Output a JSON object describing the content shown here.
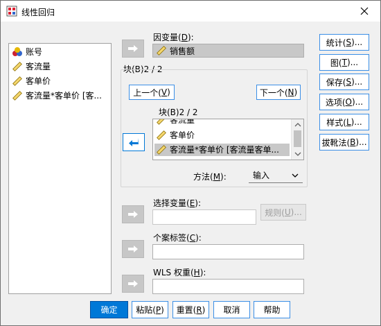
{
  "window": {
    "title": "线性回归",
    "close_glyph": "✕"
  },
  "variables": {
    "items": [
      {
        "label": "账号",
        "icon": "nominal-icon"
      },
      {
        "label": "客流量",
        "icon": "scale-icon"
      },
      {
        "label": "客单价",
        "icon": "scale-icon"
      },
      {
        "label": "客流量*客单价 [客...",
        "icon": "scale-icon"
      }
    ]
  },
  "dependent": {
    "label_pre": "因变量(",
    "label_key": "D",
    "label_post": "):",
    "value": "销售额"
  },
  "block": {
    "legend": "块(B)2 / 2",
    "prev_pre": "上一个(",
    "prev_key": "V",
    "prev_post": ")",
    "next_pre": "下一个(",
    "next_key": "N",
    "next_post": ")",
    "inner_title": "块(B)2 / 2",
    "items": [
      "客流量",
      "客单价",
      "客流量*客单价 [客流量客单..."
    ],
    "method_pre": "方法(",
    "method_key": "M",
    "method_post": "):",
    "method_value": "输入"
  },
  "selection": {
    "label_pre": "选择变量(",
    "label_key": "E",
    "label_post": "):",
    "value": "",
    "rule_pre": "规则(",
    "rule_key": "U",
    "rule_post": ")..."
  },
  "case_label": {
    "label_pre": "个案标签(",
    "label_key": "C",
    "label_post": "):",
    "value": ""
  },
  "wls": {
    "label_pre": "WLS 权重(",
    "label_key": "H",
    "label_post": "):",
    "value": ""
  },
  "side_buttons": [
    {
      "pre": "统计(",
      "key": "S",
      "post": ")..."
    },
    {
      "pre": "图(",
      "key": "T",
      "post": ")..."
    },
    {
      "pre": "保存(",
      "key": "S",
      "post": ")..."
    },
    {
      "pre": "选项(",
      "key": "O",
      "post": ")..."
    },
    {
      "pre": "样式(",
      "key": "L",
      "post": ")..."
    },
    {
      "pre": "拔靴法(",
      "key": "B",
      "post": ")..."
    }
  ],
  "bottom_buttons": {
    "ok": "确定",
    "paste_pre": "粘贴(",
    "paste_key": "P",
    "paste_post": ")",
    "reset_pre": "重置(",
    "reset_key": "R",
    "reset_post": ")",
    "cancel": "取消",
    "help": "帮助"
  },
  "colors": {
    "accent": "#0078d7",
    "primary_button": "#0078d7"
  }
}
